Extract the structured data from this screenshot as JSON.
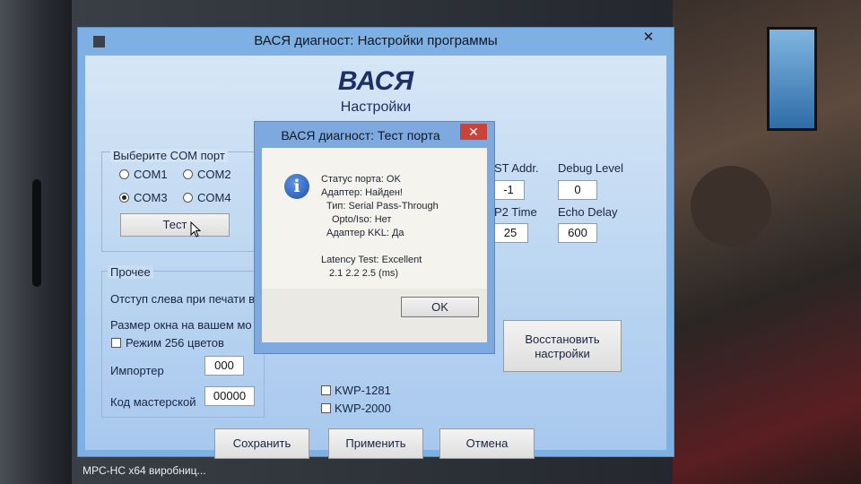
{
  "window": {
    "title": "ВАСЯ диагност: Настройки программы",
    "close_glyph": "✕",
    "app_title": "ВАСЯ",
    "app_subtitle": "Настройки"
  },
  "com_port": {
    "label": "Выберите COM порт",
    "options": [
      "COM1",
      "COM2",
      "COM3",
      "COM4"
    ],
    "selected": "COM3",
    "test_button": "Тест"
  },
  "top_fields": {
    "st_addr_label": "ST Addr.",
    "st_addr_value": "-1",
    "debug_label": "Debug Level",
    "debug_value": "0",
    "p2_label": "P2 Time",
    "p2_value": "25",
    "echo_label": "Echo Delay",
    "echo_value": "600"
  },
  "misc": {
    "group_label": "Прочее",
    "left_indent_label": "Отступ слева при печати в",
    "window_size_label": "Размер окна на вашем мо",
    "mode256_label": "Режим 256 цветов",
    "importer_label": "Импортер",
    "importer_value": "000",
    "workshop_label": "Код мастерской",
    "workshop_value": "00000",
    "kwp1281_label": "KWP-1281",
    "kwp2000_label": "KWP-2000",
    "restore_button_line1": "Восстановить",
    "restore_button_line2": "настройки"
  },
  "buttons": {
    "save": "Сохранить",
    "apply": "Применить",
    "cancel": "Отмена"
  },
  "dialog": {
    "title": "ВАСЯ диагност: Тест порта",
    "close_glyph": "✕",
    "icon": "information-icon",
    "lines": [
      "Статус порта: OK",
      "Адаптер: Найден!",
      "Тип: Serial Pass-Through",
      "Opto/Iso: Нет",
      "Адаптер KKL: Да",
      "Latency Test: Excellent",
      "2.1  2.2  2.5 (ms)"
    ],
    "ok_button": "OK"
  },
  "taskbar": {
    "text": "MPC-HC x64   виробниц..."
  },
  "colors": {
    "window_frame": "#7fb0e4",
    "client_bg": "#c6dcf3",
    "dialog_close": "#c7443a",
    "info_icon": "#2a5fb8"
  }
}
